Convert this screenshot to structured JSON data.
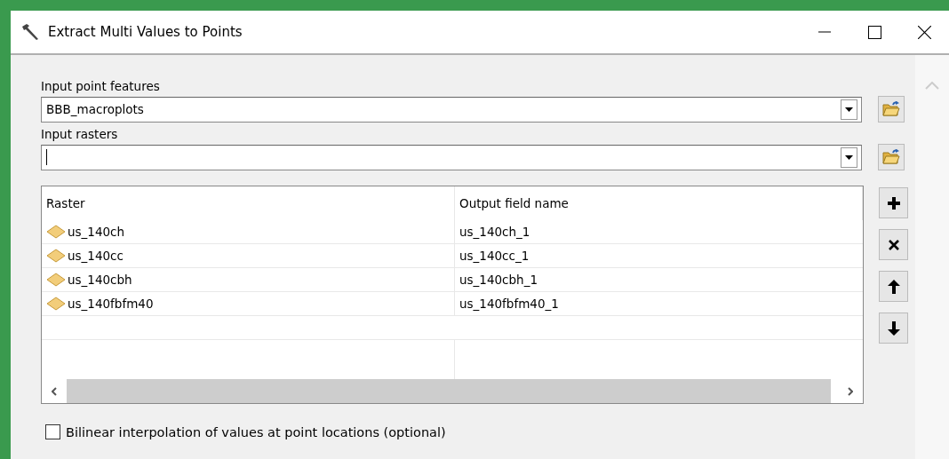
{
  "window": {
    "title": "Extract Multi Values to Points"
  },
  "fields": [
    {
      "label": "Input point features",
      "value": "BBB_macroplots"
    },
    {
      "label": "Input rasters"
    }
  ],
  "table": {
    "columns": [
      "Raster",
      "Output field name"
    ],
    "rows": [
      {
        "raster": "us_140ch",
        "output": "us_140ch_1"
      },
      {
        "raster": "us_140cc",
        "output": "us_140cc_1"
      },
      {
        "raster": "us_140cbh",
        "output": "us_140cbh_1"
      },
      {
        "raster": "us_140fbfm40",
        "output": "us_140fbfm40_1"
      }
    ]
  },
  "tools": [
    {
      "kind": "add"
    },
    {
      "kind": "remove"
    },
    {
      "kind": "up"
    },
    {
      "kind": "down"
    }
  ],
  "option": {
    "label": "Bilinear interpolation of values at point locations (optional)",
    "checked": false
  }
}
